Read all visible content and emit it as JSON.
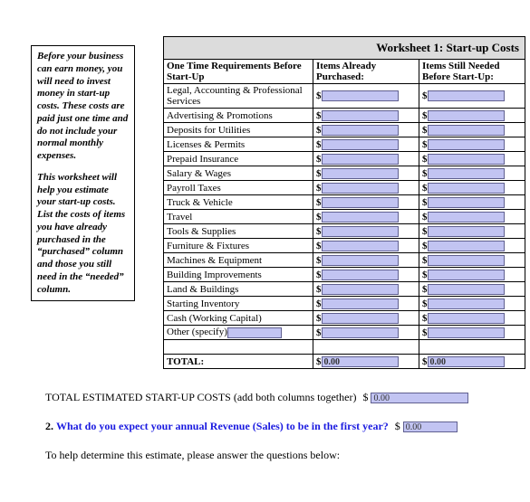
{
  "tip": {
    "p1": "Before your business can earn money, you will need to invest money in start-up costs. These costs are paid just one time and do not include your normal monthly expenses.",
    "p2": "This worksheet will help you estimate your start-up costs. List the costs of items you have already purchased in the “purchased” column and those you still need in the “needed” column."
  },
  "title": "Worksheet 1:  Start-up Costs",
  "headers": {
    "col1": "One Time Requirements Before Start-Up",
    "col2": "Items Already Purchased:",
    "col3": "Items Still Needed Before Start-Up:"
  },
  "currency": "$",
  "other_prefix": "Other (specify)",
  "rows": [
    {
      "label": "Legal, Accounting & Professional Services",
      "purchased": "",
      "needed": ""
    },
    {
      "label": "Advertising & Promotions",
      "purchased": "",
      "needed": ""
    },
    {
      "label": "Deposits for Utilities",
      "purchased": "",
      "needed": ""
    },
    {
      "label": "Licenses & Permits",
      "purchased": "",
      "needed": ""
    },
    {
      "label": "Prepaid Insurance",
      "purchased": "",
      "needed": ""
    },
    {
      "label": "Salary & Wages",
      "purchased": "",
      "needed": ""
    },
    {
      "label": "Payroll Taxes",
      "purchased": "",
      "needed": ""
    },
    {
      "label": "Truck & Vehicle",
      "purchased": "",
      "needed": ""
    },
    {
      "label": "Travel",
      "purchased": "",
      "needed": ""
    },
    {
      "label": "Tools & Supplies",
      "purchased": "",
      "needed": ""
    },
    {
      "label": "Furniture & Fixtures",
      "purchased": "",
      "needed": ""
    },
    {
      "label": "Machines & Equipment",
      "purchased": "",
      "needed": ""
    },
    {
      "label": "Building Improvements",
      "purchased": "",
      "needed": ""
    },
    {
      "label": "Land & Buildings",
      "purchased": "",
      "needed": ""
    },
    {
      "label": "Starting Inventory",
      "purchased": "",
      "needed": ""
    },
    {
      "label": "Cash (Working Capital)",
      "purchased": "",
      "needed": ""
    }
  ],
  "other_row": {
    "spec": "",
    "purchased": "",
    "needed": ""
  },
  "total": {
    "label": "TOTAL:",
    "purchased": "0.00",
    "needed": "0.00"
  },
  "footer": {
    "total_line": "TOTAL ESTIMATED START-UP COSTS (add both columns together)",
    "total_value": "0.00",
    "q2_num": "2.",
    "q2_text": "What do you expect your annual Revenue (Sales) to be in the first year?",
    "q2_value": "0.00",
    "help_text": "To help determine this estimate, please answer the questions below:"
  }
}
